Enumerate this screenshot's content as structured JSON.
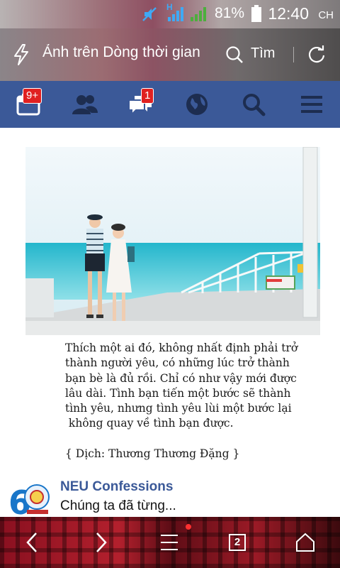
{
  "status_bar": {
    "network_label": "H",
    "battery_percent": "81%",
    "time": "12:40",
    "period": "CH"
  },
  "url_bar": {
    "title": "Ảnh trên Dòng thời gian",
    "find_label": "Tìm"
  },
  "fb_nav": {
    "notifications_badge": "9+",
    "messages_badge": "1"
  },
  "post": {
    "quote_lines": [
      "Thích một ai đó, không nhất định phải trở",
      "thành người yêu, có những lúc trở thành",
      "bạn bè là đủ rồi. Chỉ có như vậy mới được",
      "lâu dài. Tình bạn tiến một bước sẽ thành",
      "tình yêu, nhưng tình yêu lùi một bước lại",
      " không quay về tình bạn được."
    ],
    "translator": "{ Dịch: Thương Thương Đặng }",
    "page_name": "NEU Confessions",
    "snippet": "Chúng ta đã từng..."
  },
  "bottom_bar": {
    "tab_count": "2"
  }
}
